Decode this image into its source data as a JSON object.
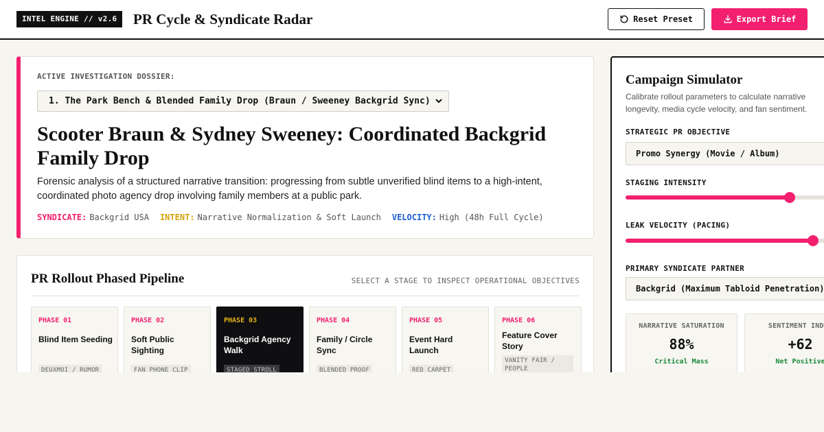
{
  "header": {
    "badge": "INTEL ENGINE // v2.6",
    "title": "PR Cycle & Syndicate Radar",
    "reset_label": "Reset Preset",
    "export_label": "Export Brief"
  },
  "dossier": {
    "label": "ACTIVE INVESTIGATION DOSSIER:",
    "selected": "1. The Park Bench & Blended Family Drop (Braun / Sweeney Backgrid Sync)",
    "title": "Scooter Braun & Sydney Sweeney: Coordinated Backgrid Family Drop",
    "description": "Forensic analysis of a structured narrative transition: progressing from subtle unverified blind items to a high-intent, coordinated photo agency drop involving family members at a public park.",
    "meta": {
      "syndicate_key": "SYNDICATE:",
      "syndicate_value": "Backgrid USA",
      "intent_key": "INTENT:",
      "intent_value": "Narrative Normalization & Soft Launch",
      "velocity_key": "VELOCITY:",
      "velocity_value": "High (48h Full Cycle)"
    }
  },
  "pipeline": {
    "title": "PR Rollout Phased Pipeline",
    "hint": "SELECT A STAGE TO INSPECT OPERATIONAL OBJECTIVES",
    "phases": [
      {
        "num": "PHASE 01",
        "name": "Blind Item Seeding",
        "tag": "DEUXMOI / RUMOR",
        "active": false
      },
      {
        "num": "PHASE 02",
        "name": "Soft Public Sighting",
        "tag": "FAN PHONE CLIP",
        "active": false
      },
      {
        "num": "PHASE 03",
        "name": "Backgrid Agency Walk",
        "tag": "STAGED STROLL",
        "active": true
      },
      {
        "num": "PHASE 04",
        "name": "Family / Circle Sync",
        "tag": "BLENDED PROOF",
        "active": false
      },
      {
        "num": "PHASE 05",
        "name": "Event Hard Launch",
        "tag": "RED CARPET",
        "active": false
      },
      {
        "num": "PHASE 06",
        "name": "Feature Cover Story",
        "tag": "VANITY FAIR / PEOPLE",
        "active": false
      }
    ]
  },
  "simulator": {
    "title": "Campaign Simulator",
    "description": "Calibrate rollout parameters to calculate narrative longevity, media cycle velocity, and fan sentiment.",
    "objective_label": "STRATEGIC PR OBJECTIVE",
    "objective_value": "Promo Synergy (Movie / Album)",
    "staging_label": "STAGING INTENSITY",
    "staging_value": 0.77,
    "leak_label": "LEAK VELOCITY (PACING)",
    "leak_value": 0.88,
    "partner_label": "PRIMARY SYNDICATE PARTNER",
    "partner_value": "Backgrid (Maximum Tabloid Penetration)",
    "metrics": {
      "saturation_label": "NARRATIVE SATURATION",
      "saturation_value": "88%",
      "saturation_status": "Critical Mass",
      "sentiment_label": "SENTIMENT INDEX",
      "sentiment_value": "+62",
      "sentiment_status": "Net Positive"
    }
  },
  "colors": {
    "accent": "#f2206e",
    "intent": "#d4a10a",
    "velocity": "#1f5fd6",
    "positive": "#1a8a3a"
  }
}
